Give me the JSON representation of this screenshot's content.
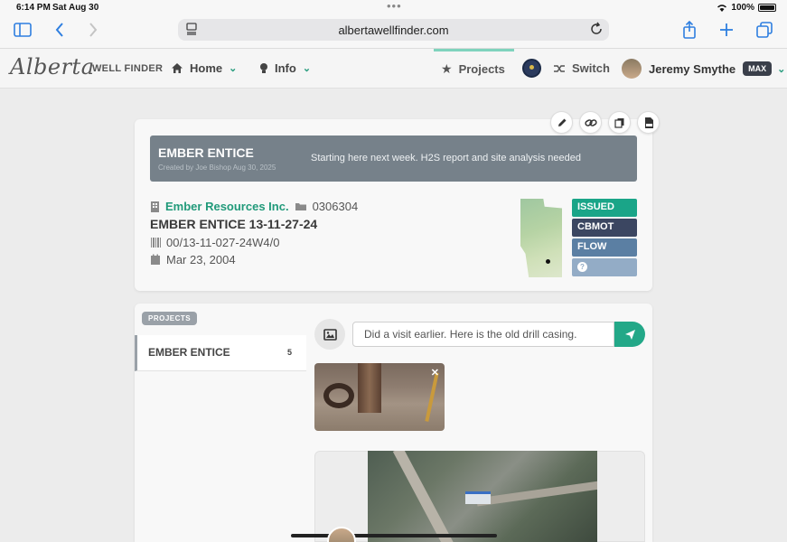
{
  "status_bar": {
    "time": "6:14 PM",
    "date": "Sat Aug 30",
    "battery": "100%"
  },
  "browser": {
    "url": "albertawellfinder.com"
  },
  "nav": {
    "logo_script": "Alberta",
    "logo_sub": "WELL FINDER",
    "home_label": "Home",
    "info_label": "Info",
    "projects_label": "Projects",
    "switch_label": "Switch",
    "user_name": "Jeremy Smythe",
    "user_badge": "MAX"
  },
  "well_card": {
    "banner_title": "EMBER ENTICE",
    "banner_created": "Created by Joe Bishop Aug 30, 2025",
    "banner_note": "Starting here next week. H2S report and site analysis needed",
    "company": "Ember Resources Inc.",
    "licence": "0306304",
    "well_name": "EMBER ENTICE 13-11-27-24",
    "uwi": "00/13-11-027-24W4/0",
    "date": "Mar 23, 2004",
    "statuses": [
      {
        "label": "ISSUED",
        "color": "#1aa588"
      },
      {
        "label": "CBMOT",
        "color": "#3b4661"
      },
      {
        "label": "FLOW",
        "color": "#5b7fa3"
      },
      {
        "label": "?",
        "color": "#93acc6"
      }
    ]
  },
  "projects": {
    "section_label": "PROJECTS",
    "items": [
      {
        "name": "EMBER ENTICE",
        "count": "5"
      }
    ]
  },
  "comment": {
    "value": "Did a visit earlier. Here is the old drill casing."
  },
  "colors": {
    "accent": "#23a888",
    "banner": "#76818a"
  }
}
